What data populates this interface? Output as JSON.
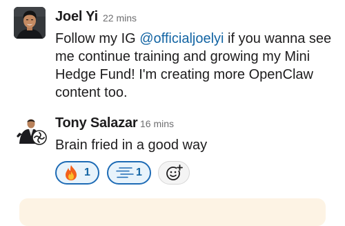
{
  "messages": [
    {
      "author": "Joel Yi",
      "time": "22 mins",
      "text_before": "Follow my IG ",
      "mention": "@officialjoelyi",
      "text_after": " if you wanna see me continue training and growing my Mini Hedge Fund! I'm creating more OpenClaw content too."
    },
    {
      "author": "Tony Salazar",
      "time": "16 mins",
      "text": "Brain fried in a good way"
    }
  ],
  "reactions": [
    {
      "icon": "fire-emoji-icon",
      "count": "1"
    },
    {
      "icon": "speed-lines-icon",
      "count": "1"
    }
  ],
  "add_reaction_icon": "add-reaction-icon",
  "colors": {
    "link": "#1264a3",
    "reaction_border": "#1d6bb5",
    "reaction_bg": "#e8f3fb",
    "card_bg": "#fdf3e4"
  }
}
